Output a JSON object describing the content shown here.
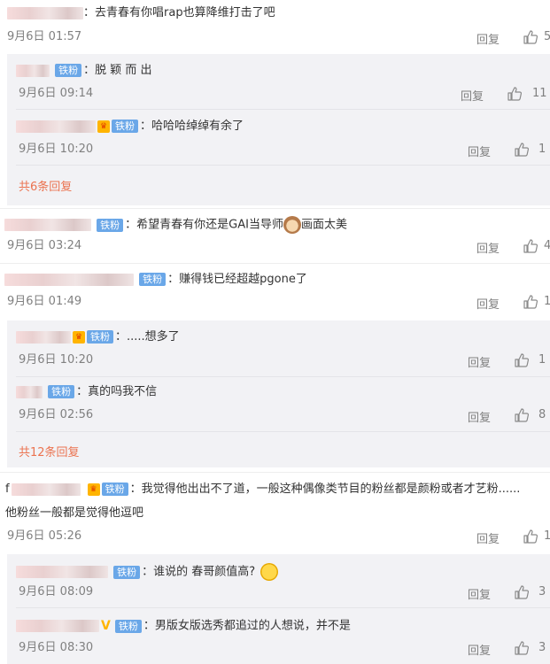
{
  "theme": {
    "badge_color": "#6aa7e8",
    "link_color": "#eb7350",
    "meta_color": "#808080"
  },
  "icons": {
    "like": "thumbs-up-icon",
    "vip": "crown-icon",
    "verified": "v-icon",
    "cat_emoji": "cat-emoji",
    "face_emoji": "sweat-smile-emoji"
  },
  "badge_label": "铁粉",
  "reply_label": "回复",
  "comments": [
    {
      "text": "去青春有你唱rap也算降维打击了吧",
      "date": "9月6日 01:57",
      "likes": "5",
      "replies": [
        {
          "text": "脱 颖 而 出",
          "date": "9月6日 09:14",
          "likes": "11"
        },
        {
          "text": "哈哈哈绰绰有余了",
          "date": "9月6日 10:20",
          "likes": "1"
        }
      ],
      "more": "共6条回复"
    },
    {
      "text": "希望青春有你还是GAI当导师",
      "text_after": "画面太美",
      "date": "9月6日 03:24",
      "likes": "4"
    },
    {
      "text": "赚得钱已经超越pgone了",
      "date": "9月6日 01:49",
      "likes": "1",
      "replies": [
        {
          "text": ".....想多了",
          "date": "9月6日 10:20",
          "likes": "1"
        },
        {
          "text": "真的吗我不信",
          "date": "9月6日 02:56",
          "likes": "8"
        }
      ],
      "more": "共12条回复"
    },
    {
      "name_prefix": "f",
      "text": "我觉得他出出不了道，一般这种偶像类节目的粉丝都是颜粉或者才艺粉......",
      "text_line2": "他粉丝一般都是觉得他逗吧",
      "date": "9月6日 05:26",
      "likes": "1",
      "replies": [
        {
          "text": "谁说的 春哥颜值高?",
          "date": "9月6日 08:09",
          "likes": "3"
        },
        {
          "text": "男版女版选秀都追过的人想说，并不是",
          "date": "9月6日 08:30",
          "likes": "3"
        }
      ]
    }
  ]
}
